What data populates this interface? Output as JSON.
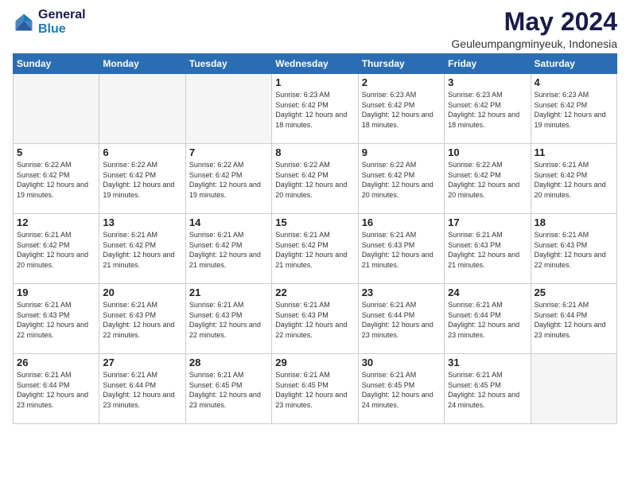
{
  "header": {
    "logo_general": "General",
    "logo_blue": "Blue",
    "month_title": "May 2024",
    "location": "Geuleumpangminyeuk, Indonesia"
  },
  "days_of_week": [
    "Sunday",
    "Monday",
    "Tuesday",
    "Wednesday",
    "Thursday",
    "Friday",
    "Saturday"
  ],
  "weeks": [
    [
      {
        "day": "",
        "sunrise": "",
        "sunset": "",
        "daylight": ""
      },
      {
        "day": "",
        "sunrise": "",
        "sunset": "",
        "daylight": ""
      },
      {
        "day": "",
        "sunrise": "",
        "sunset": "",
        "daylight": ""
      },
      {
        "day": "1",
        "sunrise": "Sunrise: 6:23 AM",
        "sunset": "Sunset: 6:42 PM",
        "daylight": "Daylight: 12 hours and 18 minutes."
      },
      {
        "day": "2",
        "sunrise": "Sunrise: 6:23 AM",
        "sunset": "Sunset: 6:42 PM",
        "daylight": "Daylight: 12 hours and 18 minutes."
      },
      {
        "day": "3",
        "sunrise": "Sunrise: 6:23 AM",
        "sunset": "Sunset: 6:42 PM",
        "daylight": "Daylight: 12 hours and 18 minutes."
      },
      {
        "day": "4",
        "sunrise": "Sunrise: 6:23 AM",
        "sunset": "Sunset: 6:42 PM",
        "daylight": "Daylight: 12 hours and 19 minutes."
      }
    ],
    [
      {
        "day": "5",
        "sunrise": "Sunrise: 6:22 AM",
        "sunset": "Sunset: 6:42 PM",
        "daylight": "Daylight: 12 hours and 19 minutes."
      },
      {
        "day": "6",
        "sunrise": "Sunrise: 6:22 AM",
        "sunset": "Sunset: 6:42 PM",
        "daylight": "Daylight: 12 hours and 19 minutes."
      },
      {
        "day": "7",
        "sunrise": "Sunrise: 6:22 AM",
        "sunset": "Sunset: 6:42 PM",
        "daylight": "Daylight: 12 hours and 19 minutes."
      },
      {
        "day": "8",
        "sunrise": "Sunrise: 6:22 AM",
        "sunset": "Sunset: 6:42 PM",
        "daylight": "Daylight: 12 hours and 20 minutes."
      },
      {
        "day": "9",
        "sunrise": "Sunrise: 6:22 AM",
        "sunset": "Sunset: 6:42 PM",
        "daylight": "Daylight: 12 hours and 20 minutes."
      },
      {
        "day": "10",
        "sunrise": "Sunrise: 6:22 AM",
        "sunset": "Sunset: 6:42 PM",
        "daylight": "Daylight: 12 hours and 20 minutes."
      },
      {
        "day": "11",
        "sunrise": "Sunrise: 6:21 AM",
        "sunset": "Sunset: 6:42 PM",
        "daylight": "Daylight: 12 hours and 20 minutes."
      }
    ],
    [
      {
        "day": "12",
        "sunrise": "Sunrise: 6:21 AM",
        "sunset": "Sunset: 6:42 PM",
        "daylight": "Daylight: 12 hours and 20 minutes."
      },
      {
        "day": "13",
        "sunrise": "Sunrise: 6:21 AM",
        "sunset": "Sunset: 6:42 PM",
        "daylight": "Daylight: 12 hours and 21 minutes."
      },
      {
        "day": "14",
        "sunrise": "Sunrise: 6:21 AM",
        "sunset": "Sunset: 6:42 PM",
        "daylight": "Daylight: 12 hours and 21 minutes."
      },
      {
        "day": "15",
        "sunrise": "Sunrise: 6:21 AM",
        "sunset": "Sunset: 6:42 PM",
        "daylight": "Daylight: 12 hours and 21 minutes."
      },
      {
        "day": "16",
        "sunrise": "Sunrise: 6:21 AM",
        "sunset": "Sunset: 6:43 PM",
        "daylight": "Daylight: 12 hours and 21 minutes."
      },
      {
        "day": "17",
        "sunrise": "Sunrise: 6:21 AM",
        "sunset": "Sunset: 6:43 PM",
        "daylight": "Daylight: 12 hours and 21 minutes."
      },
      {
        "day": "18",
        "sunrise": "Sunrise: 6:21 AM",
        "sunset": "Sunset: 6:43 PM",
        "daylight": "Daylight: 12 hours and 22 minutes."
      }
    ],
    [
      {
        "day": "19",
        "sunrise": "Sunrise: 6:21 AM",
        "sunset": "Sunset: 6:43 PM",
        "daylight": "Daylight: 12 hours and 22 minutes."
      },
      {
        "day": "20",
        "sunrise": "Sunrise: 6:21 AM",
        "sunset": "Sunset: 6:43 PM",
        "daylight": "Daylight: 12 hours and 22 minutes."
      },
      {
        "day": "21",
        "sunrise": "Sunrise: 6:21 AM",
        "sunset": "Sunset: 6:43 PM",
        "daylight": "Daylight: 12 hours and 22 minutes."
      },
      {
        "day": "22",
        "sunrise": "Sunrise: 6:21 AM",
        "sunset": "Sunset: 6:43 PM",
        "daylight": "Daylight: 12 hours and 22 minutes."
      },
      {
        "day": "23",
        "sunrise": "Sunrise: 6:21 AM",
        "sunset": "Sunset: 6:44 PM",
        "daylight": "Daylight: 12 hours and 23 minutes."
      },
      {
        "day": "24",
        "sunrise": "Sunrise: 6:21 AM",
        "sunset": "Sunset: 6:44 PM",
        "daylight": "Daylight: 12 hours and 23 minutes."
      },
      {
        "day": "25",
        "sunrise": "Sunrise: 6:21 AM",
        "sunset": "Sunset: 6:44 PM",
        "daylight": "Daylight: 12 hours and 23 minutes."
      }
    ],
    [
      {
        "day": "26",
        "sunrise": "Sunrise: 6:21 AM",
        "sunset": "Sunset: 6:44 PM",
        "daylight": "Daylight: 12 hours and 23 minutes."
      },
      {
        "day": "27",
        "sunrise": "Sunrise: 6:21 AM",
        "sunset": "Sunset: 6:44 PM",
        "daylight": "Daylight: 12 hours and 23 minutes."
      },
      {
        "day": "28",
        "sunrise": "Sunrise: 6:21 AM",
        "sunset": "Sunset: 6:45 PM",
        "daylight": "Daylight: 12 hours and 23 minutes."
      },
      {
        "day": "29",
        "sunrise": "Sunrise: 6:21 AM",
        "sunset": "Sunset: 6:45 PM",
        "daylight": "Daylight: 12 hours and 23 minutes."
      },
      {
        "day": "30",
        "sunrise": "Sunrise: 6:21 AM",
        "sunset": "Sunset: 6:45 PM",
        "daylight": "Daylight: 12 hours and 24 minutes."
      },
      {
        "day": "31",
        "sunrise": "Sunrise: 6:21 AM",
        "sunset": "Sunset: 6:45 PM",
        "daylight": "Daylight: 12 hours and 24 minutes."
      },
      {
        "day": "",
        "sunrise": "",
        "sunset": "",
        "daylight": ""
      }
    ]
  ]
}
